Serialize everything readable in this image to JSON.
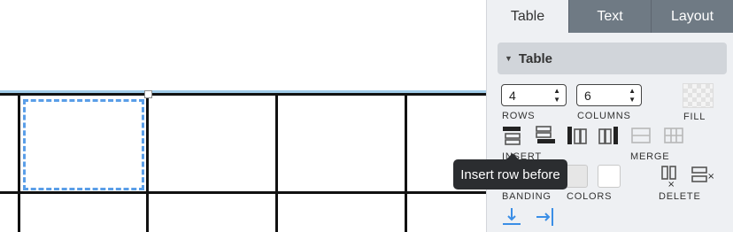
{
  "tabs": [
    {
      "label": "Table",
      "active": true
    },
    {
      "label": "Text",
      "active": false
    },
    {
      "label": "Layout",
      "active": false
    }
  ],
  "section": {
    "title": "Table"
  },
  "rows": {
    "value": "4",
    "label": "ROWS"
  },
  "columns": {
    "value": "6",
    "label": "COLUMNS"
  },
  "fill": {
    "label": "FILL"
  },
  "insert": {
    "label": "INSERT"
  },
  "merge": {
    "label": "MERGE"
  },
  "banding": {
    "label": "BANDING"
  },
  "colors": {
    "label": "COLORS"
  },
  "delete": {
    "label": "DELETE"
  },
  "tooltip": {
    "text": "Insert row before"
  },
  "icons": [
    "insert-row-before-icon",
    "insert-row-after-icon",
    "insert-column-before-icon",
    "insert-column-after-icon",
    "merge-rows-icon",
    "merge-columns-icon",
    "delete-column-icon",
    "delete-row-icon",
    "banding-rows-icon",
    "banding-columns-icon"
  ],
  "colors_palette": {
    "accent": "#5a9ee8",
    "selection_line": "#9fcbe8",
    "tab_inactive": "#6f7a84",
    "tooltip_bg": "#2b2d30"
  }
}
